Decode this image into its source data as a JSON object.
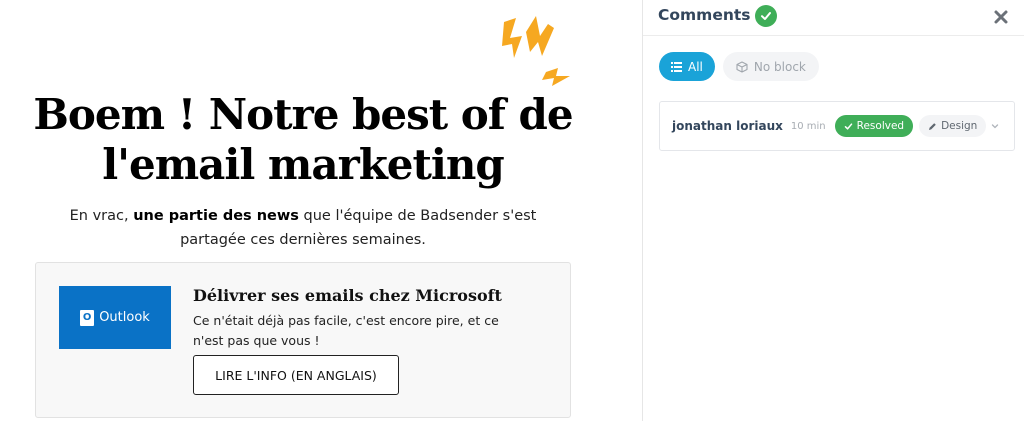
{
  "email": {
    "headline_line1": "Boem ! Notre best of de",
    "headline_line2": "l'email marketing",
    "intro_prefix": "En vrac, ",
    "intro_bold": "une partie des news",
    "intro_suffix": " que l'équipe de Badsender s'est partagée ces dernières semaines.",
    "card": {
      "logo_text": "Outlook",
      "title": "Délivrer ses emails chez Microsoft",
      "text": "Ce n'était déjà pas facile, c'est encore pire, et ce n'est pas que vous !",
      "button_label": "LIRE L'INFO (EN ANGLAIS)"
    },
    "accent_color": "#f6a821",
    "logo_color": "#0a72c6"
  },
  "panel": {
    "title": "Comments",
    "filters": [
      {
        "label": "All",
        "icon": "list-icon",
        "active": true
      },
      {
        "label": "No block",
        "icon": "cube-icon",
        "active": false
      }
    ],
    "comments": [
      {
        "author": "jonathan loriaux",
        "time": "10 min",
        "status": "Resolved",
        "tag": "Design"
      }
    ],
    "colors": {
      "title": "#33465c",
      "resolved": "#3fae58",
      "filter_active": "#1aa3d8"
    }
  }
}
